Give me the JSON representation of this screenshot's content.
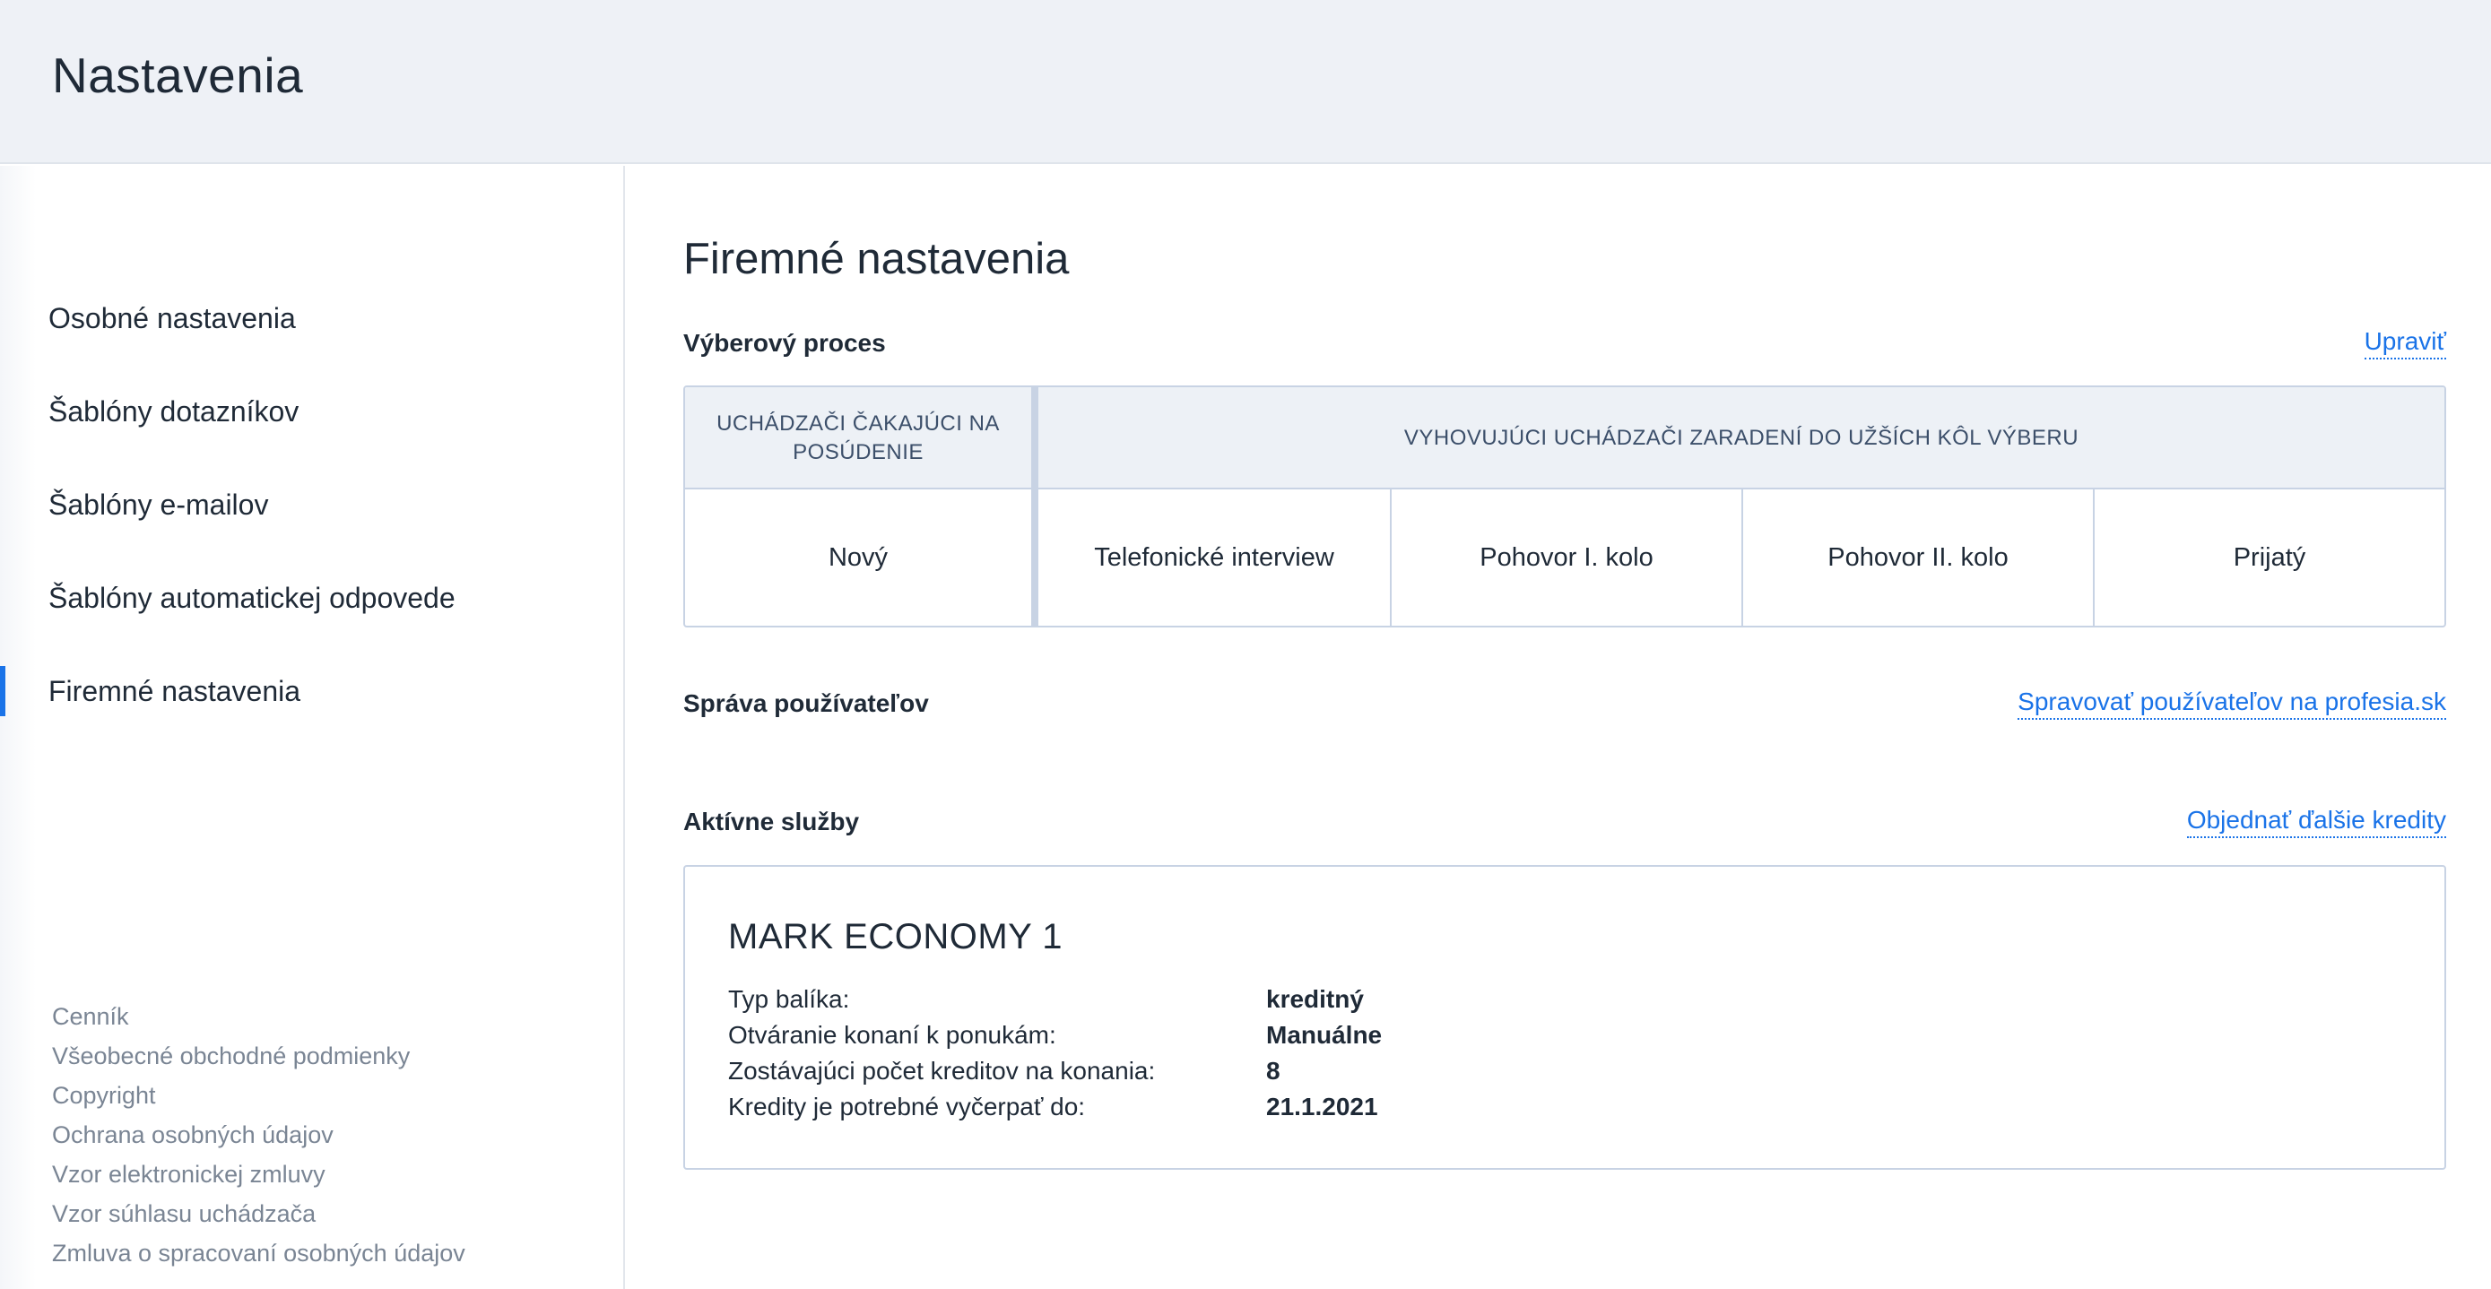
{
  "header": {
    "title": "Nastavenia"
  },
  "sidebar": {
    "items": [
      {
        "label": "Osobné nastavenia"
      },
      {
        "label": "Šablóny dotazníkov"
      },
      {
        "label": "Šablóny e-mailov"
      },
      {
        "label": "Šablóny automatickej odpovede"
      },
      {
        "label": "Firemné nastavenia",
        "active": true
      }
    ],
    "footer_links": [
      "Cenník",
      "Všeobecné obchodné podmienky",
      "Copyright",
      "Ochrana osobných údajov",
      "Vzor elektronickej zmluvy",
      "Vzor súhlasu uchádzača",
      "Zmluva o spracovaní osobných údajov"
    ]
  },
  "main": {
    "title": "Firemné nastavenia",
    "selection_process": {
      "label": "Výberový proces",
      "edit_link": "Upraviť",
      "header_waiting": "UCHÁDZAČI ČAKAJÚCI NA POSÚDENIE",
      "header_shortlist": "VYHOVUJÚCI UCHÁDZAČI ZARADENÍ DO UŽŠÍCH KÔL VÝBERU",
      "stages": [
        "Nový",
        "Telefonické interview",
        "Pohovor I. kolo",
        "Pohovor II. kolo",
        "Prijatý"
      ]
    },
    "user_management": {
      "label": "Správa používateľov",
      "link": "Spravovať používateľov na profesia.sk"
    },
    "active_services": {
      "label": "Aktívne služby",
      "link": "Objednať ďalšie kredity",
      "service": {
        "name": "MARK ECONOMY 1",
        "rows": [
          {
            "key": "Typ balíka:",
            "value": "kreditný"
          },
          {
            "key": "Otváranie konaní k ponukám:",
            "value": "Manuálne"
          },
          {
            "key": "Zostávajúci počet kreditov na konania:",
            "value": "8"
          },
          {
            "key": "Kredity je potrebné vyčerpať do:",
            "value": "21.1.2021"
          }
        ]
      }
    }
  },
  "colors": {
    "accent": "#1a73e8",
    "header_bg": "#eef1f6",
    "border": "#c8d3e4"
  }
}
